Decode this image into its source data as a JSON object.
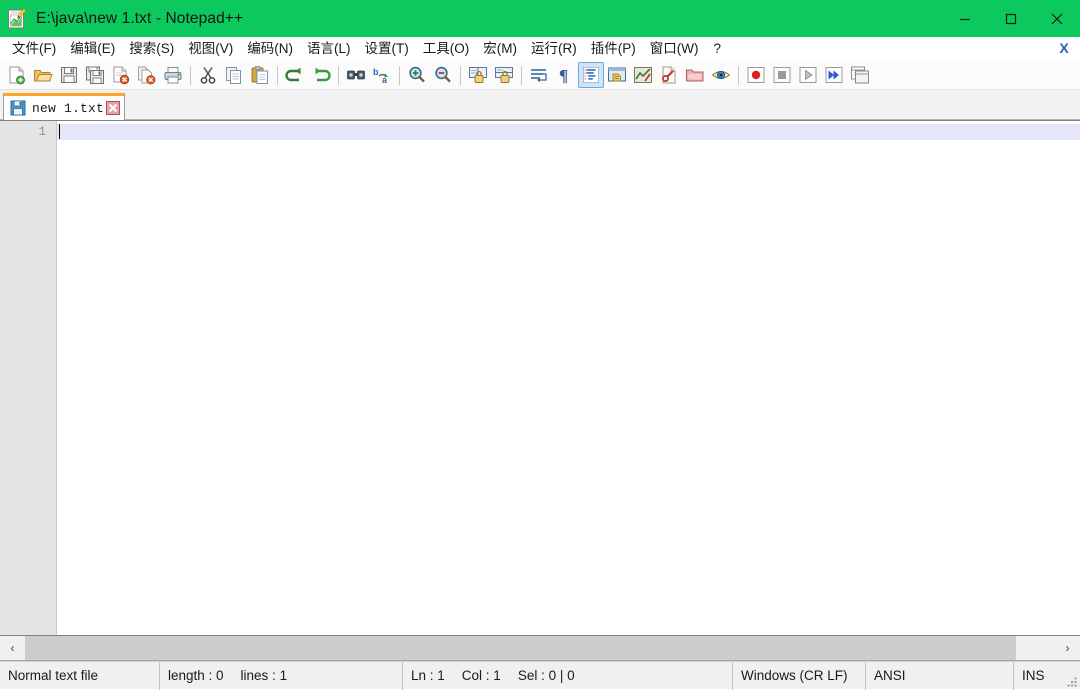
{
  "window": {
    "title": "E:\\java\\new 1.txt - Notepad++",
    "app_icon": "notepad-plus-plus-icon",
    "titlebar_color": "#0bc95c",
    "controls": {
      "minimize_label": "–",
      "maximize_label": "□",
      "close_label": "✕"
    }
  },
  "menu": {
    "items": [
      {
        "label": "文件(F)",
        "name": "menu-file"
      },
      {
        "label": "编辑(E)",
        "name": "menu-edit"
      },
      {
        "label": "搜索(S)",
        "name": "menu-search"
      },
      {
        "label": "视图(V)",
        "name": "menu-view"
      },
      {
        "label": "编码(N)",
        "name": "menu-encoding"
      },
      {
        "label": "语言(L)",
        "name": "menu-language"
      },
      {
        "label": "设置(T)",
        "name": "menu-settings"
      },
      {
        "label": "工具(O)",
        "name": "menu-tools"
      },
      {
        "label": "宏(M)",
        "name": "menu-macro"
      },
      {
        "label": "运行(R)",
        "name": "menu-run"
      },
      {
        "label": "插件(P)",
        "name": "menu-plugins"
      },
      {
        "label": "窗口(W)",
        "name": "menu-window"
      },
      {
        "label": "?",
        "name": "menu-help"
      }
    ],
    "close_document_label": "X"
  },
  "toolbar": {
    "buttons": [
      {
        "name": "new-file-icon",
        "tooltip": "New"
      },
      {
        "name": "open-file-icon",
        "tooltip": "Open"
      },
      {
        "name": "save-icon",
        "tooltip": "Save"
      },
      {
        "name": "save-all-icon",
        "tooltip": "Save All"
      },
      {
        "name": "close-file-icon",
        "tooltip": "Close"
      },
      {
        "name": "close-all-files-icon",
        "tooltip": "Close All"
      },
      {
        "name": "print-icon",
        "tooltip": "Print"
      },
      {
        "name": "separator-1",
        "tooltip": ""
      },
      {
        "name": "cut-icon",
        "tooltip": "Cut"
      },
      {
        "name": "copy-icon",
        "tooltip": "Copy"
      },
      {
        "name": "paste-icon",
        "tooltip": "Paste"
      },
      {
        "name": "separator-2",
        "tooltip": ""
      },
      {
        "name": "undo-icon",
        "tooltip": "Undo"
      },
      {
        "name": "redo-icon",
        "tooltip": "Redo"
      },
      {
        "name": "separator-3",
        "tooltip": ""
      },
      {
        "name": "find-icon",
        "tooltip": "Find"
      },
      {
        "name": "replace-icon",
        "tooltip": "Replace"
      },
      {
        "name": "separator-4",
        "tooltip": ""
      },
      {
        "name": "zoom-in-icon",
        "tooltip": "Zoom In"
      },
      {
        "name": "zoom-out-icon",
        "tooltip": "Zoom Out"
      },
      {
        "name": "separator-5",
        "tooltip": ""
      },
      {
        "name": "sync-vertical-scroll-icon",
        "tooltip": "Sync Vertical Scrolling"
      },
      {
        "name": "sync-horizontal-scroll-icon",
        "tooltip": "Sync Horizontal Scrolling"
      },
      {
        "name": "separator-6",
        "tooltip": ""
      },
      {
        "name": "word-wrap-icon",
        "tooltip": "Word Wrap"
      },
      {
        "name": "show-all-characters-icon",
        "tooltip": "Show All Characters"
      },
      {
        "name": "indent-guide-icon",
        "tooltip": "Show Indent Guide",
        "toggled": true
      },
      {
        "name": "user-defined-dialog-icon",
        "tooltip": "User Defined Dialogue"
      },
      {
        "name": "document-map-icon",
        "tooltip": "Document Map"
      },
      {
        "name": "function-list-icon",
        "tooltip": "Function List"
      },
      {
        "name": "folder-as-workspace-icon",
        "tooltip": "Folder as Workspace"
      },
      {
        "name": "monitoring-icon",
        "tooltip": "Monitoring"
      },
      {
        "name": "separator-7",
        "tooltip": ""
      },
      {
        "name": "record-macro-icon",
        "tooltip": "Start Recording"
      },
      {
        "name": "stop-macro-icon",
        "tooltip": "Stop Recording"
      },
      {
        "name": "play-macro-icon",
        "tooltip": "Playback"
      },
      {
        "name": "run-macro-multiple-icon",
        "tooltip": "Run a Macro Multiple Times"
      },
      {
        "name": "save-macro-icon",
        "tooltip": "Save Current Recorded Macro"
      }
    ]
  },
  "tabs": [
    {
      "label": "new 1.txt",
      "save_icon": "floppy-disk-icon",
      "close_icon": "tab-close-icon",
      "active": true,
      "accent_color": "#ffa428"
    }
  ],
  "editor": {
    "line_numbers": [
      "1"
    ],
    "content": "",
    "current_line_highlight": "#e6e6fa"
  },
  "scrollbar": {
    "left_arrow": "‹",
    "right_arrow": "›"
  },
  "status_bar": {
    "file_type": "Normal text file",
    "length_label": "length : 0",
    "lines_label": "lines : 1",
    "ln_label": "Ln : 1",
    "col_label": "Col : 1",
    "sel_label": "Sel : 0 | 0",
    "eol": "Windows (CR LF)",
    "encoding": "ANSI",
    "insert_mode": "INS"
  }
}
